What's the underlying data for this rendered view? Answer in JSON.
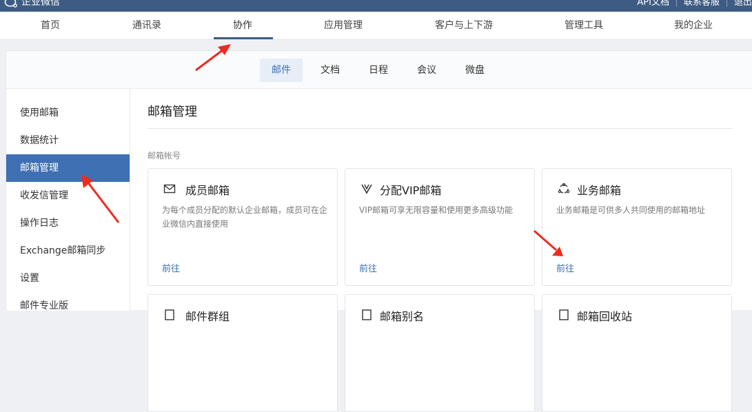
{
  "brand": {
    "name": "企业微信"
  },
  "top_links": [
    "API文档",
    "联系客服",
    "退出"
  ],
  "main_nav": {
    "items": [
      {
        "label": "首页"
      },
      {
        "label": "通讯录"
      },
      {
        "label": "协作"
      },
      {
        "label": "应用管理"
      },
      {
        "label": "客户与上下游"
      },
      {
        "label": "管理工具"
      },
      {
        "label": "我的企业"
      }
    ],
    "active": "协作"
  },
  "sub_nav": {
    "items": [
      {
        "label": "邮件"
      },
      {
        "label": "文档"
      },
      {
        "label": "日程"
      },
      {
        "label": "会议"
      },
      {
        "label": "微盘"
      }
    ],
    "active": "邮件"
  },
  "sidebar": {
    "items": [
      {
        "label": "使用邮箱"
      },
      {
        "label": "数据统计"
      },
      {
        "label": "邮箱管理"
      },
      {
        "label": "收发信管理"
      },
      {
        "label": "操作日志"
      },
      {
        "label": "Exchange邮箱同步"
      },
      {
        "label": "设置"
      },
      {
        "label": "邮件专业版"
      }
    ],
    "active": "邮箱管理"
  },
  "main": {
    "title": "邮箱管理",
    "section_label": "邮箱帐号",
    "cards": [
      {
        "icon": "envelope-icon",
        "title": "成员邮箱",
        "desc": "为每个成员分配的默认企业邮箱，成员可在企业微信内直接使用",
        "link": "前往"
      },
      {
        "icon": "vip-icon",
        "title": "分配VIP邮箱",
        "desc": "VIP邮箱可享无限容量和使用更多高级功能",
        "link": "前往"
      },
      {
        "icon": "group-icon",
        "title": "业务邮箱",
        "desc": "业务邮箱是可供多人共同使用的邮箱地址",
        "link": "前往"
      }
    ],
    "cards_row2_titles": [
      "邮件群组",
      "邮箱别名",
      "邮箱回收站"
    ]
  },
  "colors": {
    "header_bg": "#3e5c83",
    "accent": "#3e70b3",
    "annotation_arrow": "#ee2a1f"
  }
}
